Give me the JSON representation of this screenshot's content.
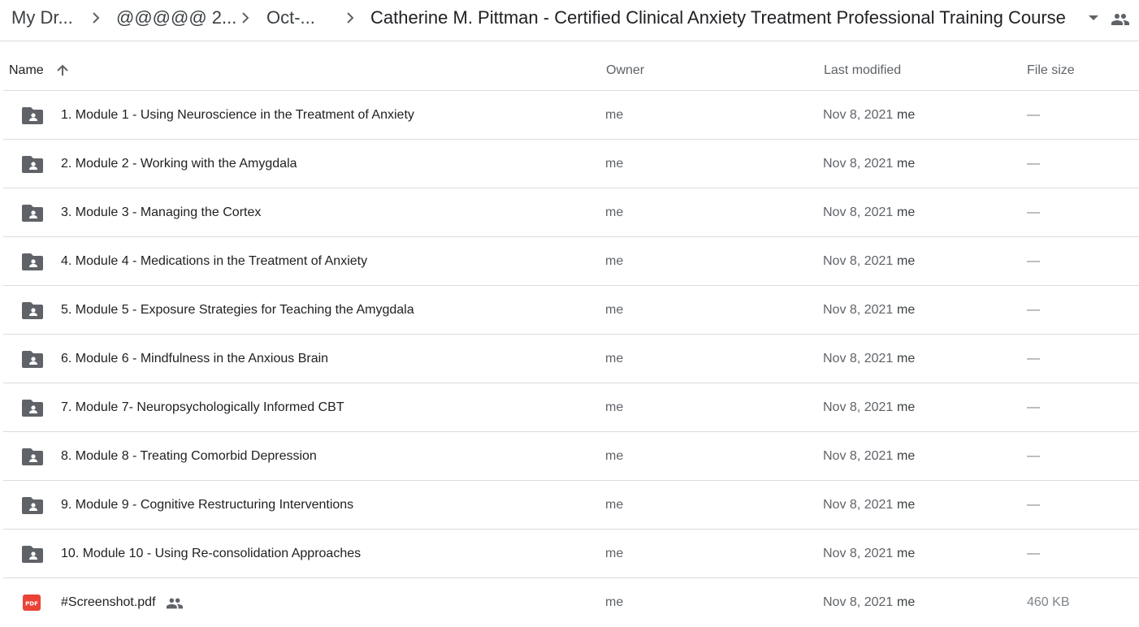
{
  "breadcrumb": {
    "items": [
      "My Dr...",
      "@@@@@ 2...",
      "Oct-...",
      "Catherine M. Pittman - Certified Clinical Anxiety Treatment Professional Training Course"
    ]
  },
  "columns": {
    "name": "Name",
    "owner": "Owner",
    "last_modified": "Last modified",
    "file_size": "File size"
  },
  "files": [
    {
      "name": "1. Module 1 - Using Neuroscience in the Treatment of Anxiety",
      "type": "shared-folder",
      "owner": "me",
      "modified": "Nov 8, 2021",
      "modified_by": "me",
      "size": "—"
    },
    {
      "name": "2. Module 2 - Working with the Amygdala",
      "type": "shared-folder",
      "owner": "me",
      "modified": "Nov 8, 2021",
      "modified_by": "me",
      "size": "—"
    },
    {
      "name": "3. Module 3 - Managing the Cortex",
      "type": "shared-folder",
      "owner": "me",
      "modified": "Nov 8, 2021",
      "modified_by": "me",
      "size": "—"
    },
    {
      "name": "4. Module 4 - Medications in the Treatment of Anxiety",
      "type": "shared-folder",
      "owner": "me",
      "modified": "Nov 8, 2021",
      "modified_by": "me",
      "size": "—"
    },
    {
      "name": "5. Module 5 - Exposure Strategies for Teaching the Amygdala",
      "type": "shared-folder",
      "owner": "me",
      "modified": "Nov 8, 2021",
      "modified_by": "me",
      "size": "—"
    },
    {
      "name": "6. Module 6 - Mindfulness in the Anxious Brain",
      "type": "shared-folder",
      "owner": "me",
      "modified": "Nov 8, 2021",
      "modified_by": "me",
      "size": "—"
    },
    {
      "name": "7. Module 7- Neuropsychologically Informed CBT",
      "type": "shared-folder",
      "owner": "me",
      "modified": "Nov 8, 2021",
      "modified_by": "me",
      "size": "—"
    },
    {
      "name": "8. Module 8 - Treating Comorbid Depression",
      "type": "shared-folder",
      "owner": "me",
      "modified": "Nov 8, 2021",
      "modified_by": "me",
      "size": "—"
    },
    {
      "name": "9. Module 9 - Cognitive Restructuring Interventions",
      "type": "shared-folder",
      "owner": "me",
      "modified": "Nov 8, 2021",
      "modified_by": "me",
      "size": "—"
    },
    {
      "name": "10. Module 10 - Using Re-consolidation Approaches",
      "type": "shared-folder",
      "owner": "me",
      "modified": "Nov 8, 2021",
      "modified_by": "me",
      "size": "—"
    },
    {
      "name": "#Screenshot.pdf",
      "type": "pdf",
      "icon_text": "PDF",
      "shared": true,
      "owner": "me",
      "modified": "Nov 8, 2021",
      "modified_by": "me",
      "size": "460 KB"
    }
  ],
  "colors": {
    "folder_icon": "#5f6368",
    "pdf_icon": "#ea4335",
    "divider": "#dadce0"
  }
}
